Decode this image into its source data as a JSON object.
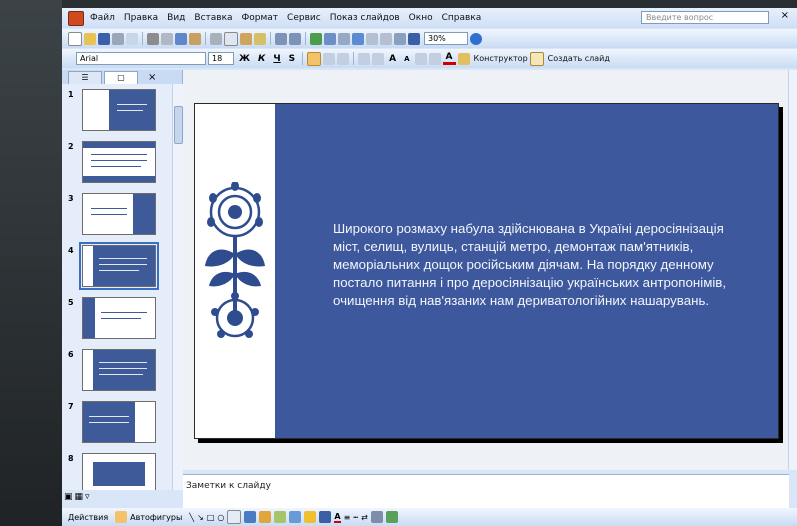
{
  "menu": {
    "items": [
      "Файл",
      "Правка",
      "Вид",
      "Вставка",
      "Формат",
      "Сервис",
      "Показ слайдов",
      "Окно",
      "Справка"
    ],
    "ask_placeholder": "Введите вопрос"
  },
  "toolbar": {
    "zoom": "30%",
    "font_name": "Arial",
    "font_size": "18",
    "designer_label": "Конструктор",
    "new_slide_label": "Создать слайд"
  },
  "slides": [
    {
      "num": "1"
    },
    {
      "num": "2"
    },
    {
      "num": "3"
    },
    {
      "num": "4"
    },
    {
      "num": "5"
    },
    {
      "num": "6"
    },
    {
      "num": "7"
    },
    {
      "num": "8"
    }
  ],
  "slide": {
    "text": "Широкого розмаху набула здійснювана в Україні деросіянізація міст, селищ, вулиць, станцій метро, демонтаж пам'ятників, меморіальних дощок російським діячам. На порядку денному постало питання і про деросіянізацію українських антропонімів, очищення від нав'язаних нам дериватологійних нашарувань."
  },
  "notes": {
    "label": "Заметки к слайду"
  },
  "drawing": {
    "actions_label": "Действия",
    "autoshapes_label": "Автофигуры"
  },
  "colors": {
    "slide_bg": "#3d589c",
    "ui_bg": "#d9e6f8",
    "ornament": "#2f4c8f"
  }
}
